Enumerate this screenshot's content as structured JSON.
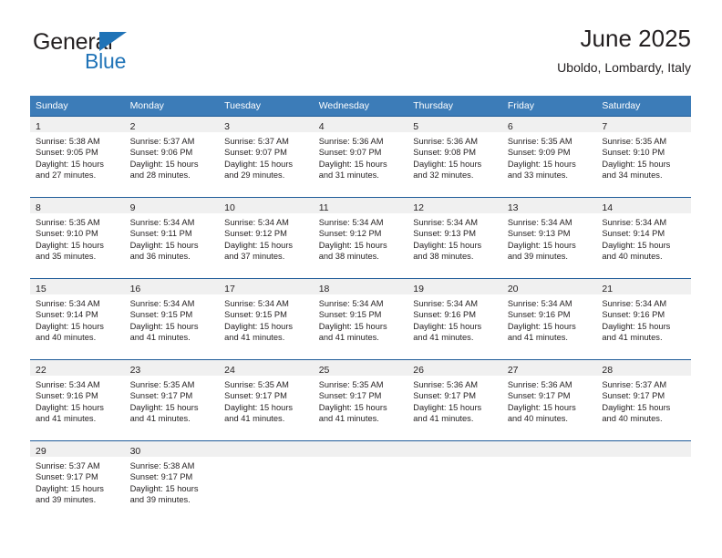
{
  "logo": {
    "line1": "General",
    "line2": "Blue",
    "triangle_icon": "triangle-icon",
    "accent_color": "#1f73b7"
  },
  "header": {
    "title": "June 2025",
    "subtitle": "Uboldo, Lombardy, Italy"
  },
  "theme": {
    "header_bg": "#3c7cb8",
    "header_text": "#ffffff",
    "daynum_band_bg": "#f0f0f0",
    "row_border": "#1f5c99",
    "text": "#231f20"
  },
  "weekday_headers": [
    "Sunday",
    "Monday",
    "Tuesday",
    "Wednesday",
    "Thursday",
    "Friday",
    "Saturday"
  ],
  "weeks": [
    [
      {
        "day": "1",
        "lines": [
          "Sunrise: 5:38 AM",
          "Sunset: 9:05 PM",
          "Daylight: 15 hours",
          "and 27 minutes."
        ]
      },
      {
        "day": "2",
        "lines": [
          "Sunrise: 5:37 AM",
          "Sunset: 9:06 PM",
          "Daylight: 15 hours",
          "and 28 minutes."
        ]
      },
      {
        "day": "3",
        "lines": [
          "Sunrise: 5:37 AM",
          "Sunset: 9:07 PM",
          "Daylight: 15 hours",
          "and 29 minutes."
        ]
      },
      {
        "day": "4",
        "lines": [
          "Sunrise: 5:36 AM",
          "Sunset: 9:07 PM",
          "Daylight: 15 hours",
          "and 31 minutes."
        ]
      },
      {
        "day": "5",
        "lines": [
          "Sunrise: 5:36 AM",
          "Sunset: 9:08 PM",
          "Daylight: 15 hours",
          "and 32 minutes."
        ]
      },
      {
        "day": "6",
        "lines": [
          "Sunrise: 5:35 AM",
          "Sunset: 9:09 PM",
          "Daylight: 15 hours",
          "and 33 minutes."
        ]
      },
      {
        "day": "7",
        "lines": [
          "Sunrise: 5:35 AM",
          "Sunset: 9:10 PM",
          "Daylight: 15 hours",
          "and 34 minutes."
        ]
      }
    ],
    [
      {
        "day": "8",
        "lines": [
          "Sunrise: 5:35 AM",
          "Sunset: 9:10 PM",
          "Daylight: 15 hours",
          "and 35 minutes."
        ]
      },
      {
        "day": "9",
        "lines": [
          "Sunrise: 5:34 AM",
          "Sunset: 9:11 PM",
          "Daylight: 15 hours",
          "and 36 minutes."
        ]
      },
      {
        "day": "10",
        "lines": [
          "Sunrise: 5:34 AM",
          "Sunset: 9:12 PM",
          "Daylight: 15 hours",
          "and 37 minutes."
        ]
      },
      {
        "day": "11",
        "lines": [
          "Sunrise: 5:34 AM",
          "Sunset: 9:12 PM",
          "Daylight: 15 hours",
          "and 38 minutes."
        ]
      },
      {
        "day": "12",
        "lines": [
          "Sunrise: 5:34 AM",
          "Sunset: 9:13 PM",
          "Daylight: 15 hours",
          "and 38 minutes."
        ]
      },
      {
        "day": "13",
        "lines": [
          "Sunrise: 5:34 AM",
          "Sunset: 9:13 PM",
          "Daylight: 15 hours",
          "and 39 minutes."
        ]
      },
      {
        "day": "14",
        "lines": [
          "Sunrise: 5:34 AM",
          "Sunset: 9:14 PM",
          "Daylight: 15 hours",
          "and 40 minutes."
        ]
      }
    ],
    [
      {
        "day": "15",
        "lines": [
          "Sunrise: 5:34 AM",
          "Sunset: 9:14 PM",
          "Daylight: 15 hours",
          "and 40 minutes."
        ]
      },
      {
        "day": "16",
        "lines": [
          "Sunrise: 5:34 AM",
          "Sunset: 9:15 PM",
          "Daylight: 15 hours",
          "and 41 minutes."
        ]
      },
      {
        "day": "17",
        "lines": [
          "Sunrise: 5:34 AM",
          "Sunset: 9:15 PM",
          "Daylight: 15 hours",
          "and 41 minutes."
        ]
      },
      {
        "day": "18",
        "lines": [
          "Sunrise: 5:34 AM",
          "Sunset: 9:15 PM",
          "Daylight: 15 hours",
          "and 41 minutes."
        ]
      },
      {
        "day": "19",
        "lines": [
          "Sunrise: 5:34 AM",
          "Sunset: 9:16 PM",
          "Daylight: 15 hours",
          "and 41 minutes."
        ]
      },
      {
        "day": "20",
        "lines": [
          "Sunrise: 5:34 AM",
          "Sunset: 9:16 PM",
          "Daylight: 15 hours",
          "and 41 minutes."
        ]
      },
      {
        "day": "21",
        "lines": [
          "Sunrise: 5:34 AM",
          "Sunset: 9:16 PM",
          "Daylight: 15 hours",
          "and 41 minutes."
        ]
      }
    ],
    [
      {
        "day": "22",
        "lines": [
          "Sunrise: 5:34 AM",
          "Sunset: 9:16 PM",
          "Daylight: 15 hours",
          "and 41 minutes."
        ]
      },
      {
        "day": "23",
        "lines": [
          "Sunrise: 5:35 AM",
          "Sunset: 9:17 PM",
          "Daylight: 15 hours",
          "and 41 minutes."
        ]
      },
      {
        "day": "24",
        "lines": [
          "Sunrise: 5:35 AM",
          "Sunset: 9:17 PM",
          "Daylight: 15 hours",
          "and 41 minutes."
        ]
      },
      {
        "day": "25",
        "lines": [
          "Sunrise: 5:35 AM",
          "Sunset: 9:17 PM",
          "Daylight: 15 hours",
          "and 41 minutes."
        ]
      },
      {
        "day": "26",
        "lines": [
          "Sunrise: 5:36 AM",
          "Sunset: 9:17 PM",
          "Daylight: 15 hours",
          "and 41 minutes."
        ]
      },
      {
        "day": "27",
        "lines": [
          "Sunrise: 5:36 AM",
          "Sunset: 9:17 PM",
          "Daylight: 15 hours",
          "and 40 minutes."
        ]
      },
      {
        "day": "28",
        "lines": [
          "Sunrise: 5:37 AM",
          "Sunset: 9:17 PM",
          "Daylight: 15 hours",
          "and 40 minutes."
        ]
      }
    ],
    [
      {
        "day": "29",
        "lines": [
          "Sunrise: 5:37 AM",
          "Sunset: 9:17 PM",
          "Daylight: 15 hours",
          "and 39 minutes."
        ]
      },
      {
        "day": "30",
        "lines": [
          "Sunrise: 5:38 AM",
          "Sunset: 9:17 PM",
          "Daylight: 15 hours",
          "and 39 minutes."
        ]
      },
      {
        "day": "",
        "lines": []
      },
      {
        "day": "",
        "lines": []
      },
      {
        "day": "",
        "lines": []
      },
      {
        "day": "",
        "lines": []
      },
      {
        "day": "",
        "lines": []
      }
    ]
  ]
}
